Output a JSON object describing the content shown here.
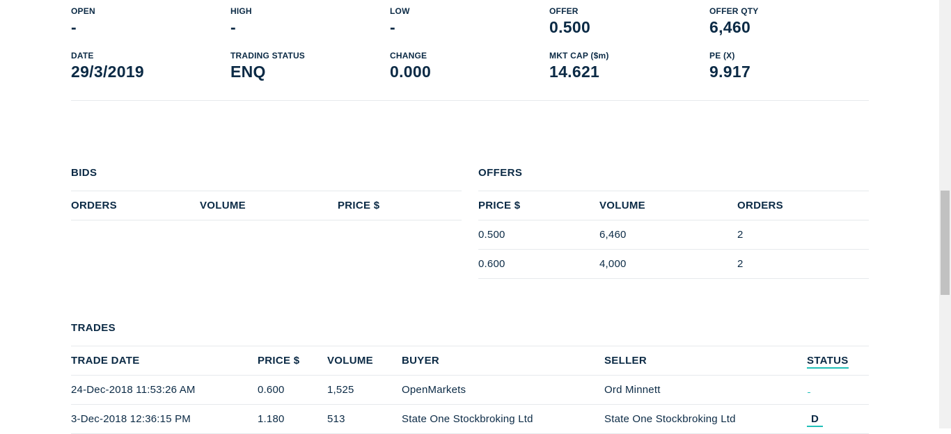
{
  "summary": {
    "row1": [
      {
        "label": "OPEN",
        "value": "-"
      },
      {
        "label": "HIGH",
        "value": "-"
      },
      {
        "label": "LOW",
        "value": "-"
      },
      {
        "label": "OFFER",
        "value": "0.500"
      },
      {
        "label": "OFFER QTY",
        "value": "6,460"
      }
    ],
    "row2": [
      {
        "label": "DATE",
        "value": "29/3/2019"
      },
      {
        "label": "TRADING STATUS",
        "value": "ENQ"
      },
      {
        "label": "CHANGE",
        "value": "0.000"
      },
      {
        "label": "MKT CAP ($m)",
        "value": "14.621"
      },
      {
        "label": "PE (X)",
        "value": "9.917"
      }
    ]
  },
  "bids": {
    "title": "BIDS",
    "headers": [
      "ORDERS",
      "VOLUME",
      "PRICE $"
    ]
  },
  "offers": {
    "title": "OFFERS",
    "headers": [
      "PRICE $",
      "VOLUME",
      "ORDERS"
    ],
    "rows": [
      [
        "0.500",
        "6,460",
        "2"
      ],
      [
        "0.600",
        "4,000",
        "2"
      ]
    ]
  },
  "trades": {
    "title": "TRADES",
    "headers": [
      "TRADE DATE",
      "PRICE $",
      "VOLUME",
      "BUYER",
      "SELLER",
      "STATUS"
    ],
    "rows": [
      [
        "24-Dec-2018 11:53:26 AM",
        "0.600",
        "1,525",
        "OpenMarkets",
        "Ord Minnett",
        ""
      ],
      [
        "3-Dec-2018 12:36:15 PM",
        "1.180",
        "513",
        "State One Stockbroking Ltd",
        "State One Stockbroking Ltd",
        "D"
      ]
    ]
  }
}
